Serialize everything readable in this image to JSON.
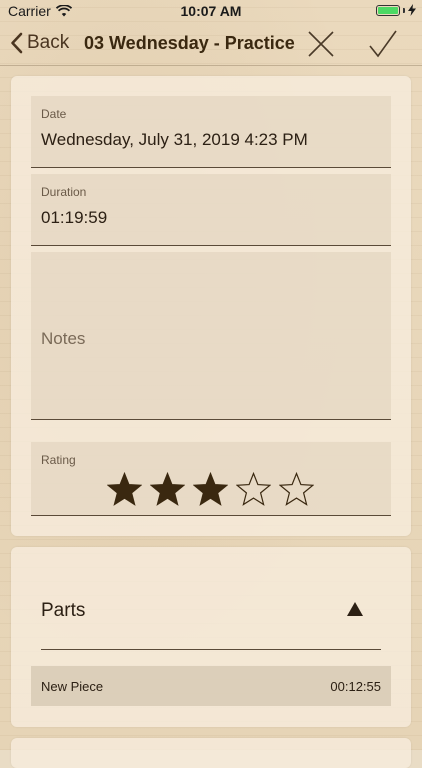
{
  "status_bar": {
    "carrier": "Carrier",
    "time": "10:07 AM",
    "battery_level": 1.0
  },
  "nav": {
    "back_label": "Back",
    "title": "03 Wednesday - Practice",
    "close_icon": "close-x-icon",
    "done_icon": "checkmark-icon"
  },
  "session": {
    "date_label": "Date",
    "date_value": "Wednesday, July 31, 2019 4:23 PM",
    "duration_label": "Duration",
    "duration_value": "01:19:59",
    "notes_placeholder": "Notes",
    "rating_label": "Rating",
    "rating_value": 3,
    "rating_max": 5
  },
  "parts": {
    "title": "Parts",
    "toggle_icon": "triangle-up-icon",
    "items": [
      {
        "name": "New Piece",
        "duration": "00:12:55"
      }
    ]
  },
  "colors": {
    "accent": "#3a2810",
    "background": "#e9dcc5",
    "star_fill": "#3a2810"
  }
}
